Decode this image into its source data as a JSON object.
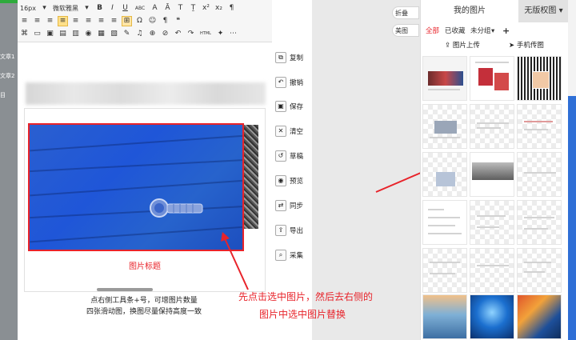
{
  "left_strip": {
    "items": [
      "文章1",
      "文章2",
      "目"
    ]
  },
  "toolbar": {
    "font_size": "16px",
    "font_family": "微软雅黑",
    "buttons_row1": [
      "B",
      "I",
      "U",
      "ABC",
      "A",
      "Ā",
      "T",
      "Ṯ",
      "x²",
      "x₂",
      "¶"
    ],
    "buttons_row2": [
      "≡",
      "≡",
      "≡",
      "≡",
      "≡",
      "≡",
      "≡",
      "≡",
      "⊞",
      "Ω",
      "☺",
      "¶",
      "❝"
    ],
    "buttons_row3": [
      "⌘",
      "▭",
      "▣",
      "▤",
      "▥",
      "◉",
      "▦",
      "▧",
      "✎",
      "♫",
      "⊕",
      "⊘",
      "↶",
      "↷",
      "HTML",
      "✦",
      "⋯"
    ]
  },
  "editor": {
    "caption": "图片标题",
    "tip_line1": "点右侧工具条+号，可增图片数量",
    "tip_line2": "四张滑动图，换图尽量保持高度一致"
  },
  "actions": [
    "复制",
    "撤销",
    "保存",
    "清空",
    "草稿",
    "预览",
    "同步",
    "导出",
    "采集"
  ],
  "action_icons": [
    "copy-icon",
    "undo-icon",
    "save-icon",
    "trash-icon",
    "draft-icon",
    "eye-icon",
    "sync-icon",
    "export-icon",
    "search-icon"
  ],
  "gap_buttons": [
    "折叠",
    "美图"
  ],
  "annotation": {
    "line1": "先点击选中图片，然后去右侧的",
    "line2": "图片中选中图片替换"
  },
  "panel": {
    "tab_mine": "我的图片",
    "tab_free": "无版权图",
    "filters": [
      "全部",
      "已收藏",
      "未分组"
    ],
    "add_label": "+",
    "upload_label": "图片上传",
    "phone_label": "手机传图"
  },
  "colors": {
    "accent_red": "#e8232a",
    "image_blue": "#1f56d8",
    "filter_active": "#e8232a",
    "brand_green": "#2eaa3c"
  }
}
